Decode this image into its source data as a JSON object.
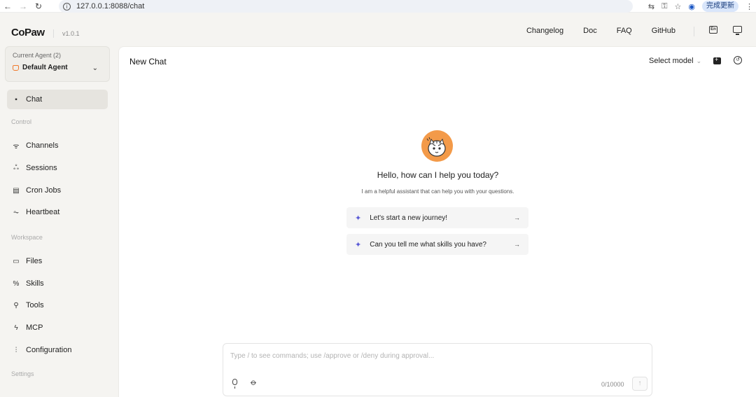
{
  "browser": {
    "url": "127.0.0.1:8088/chat",
    "update_button": "完成更新"
  },
  "header": {
    "logo": "CoPaw",
    "version": "v1.0.1",
    "links": [
      "Changelog",
      "Doc",
      "FAQ",
      "GitHub"
    ],
    "lang_icon": "En"
  },
  "sidebar": {
    "agent_label": "Current Agent (2)",
    "agent_name": "Default Agent",
    "chat": "Chat",
    "section_control": "Control",
    "channels": "Channels",
    "sessions": "Sessions",
    "cron_jobs": "Cron Jobs",
    "heartbeat": "Heartbeat",
    "section_workspace": "Workspace",
    "files": "Files",
    "skills": "Skills",
    "tools": "Tools",
    "mcp": "MCP",
    "configuration": "Configuration",
    "section_settings": "Settings"
  },
  "main": {
    "title": "New Chat",
    "select_model": "Select model",
    "greeting": "Hello, how can I help you today?",
    "sub_greeting": "I am a helpful assistant that can help you with your questions.",
    "prompts": [
      "Let's start a new journey!",
      "Can you tell me what skills you have?"
    ]
  },
  "composer": {
    "placeholder": "Type / to see commands; use /approve or /deny during approval...",
    "counter": "0/10000"
  },
  "colors": {
    "accent_orange": "#f39a49",
    "sparkle": "#5b5bd6",
    "background": "#f5f4f1"
  }
}
